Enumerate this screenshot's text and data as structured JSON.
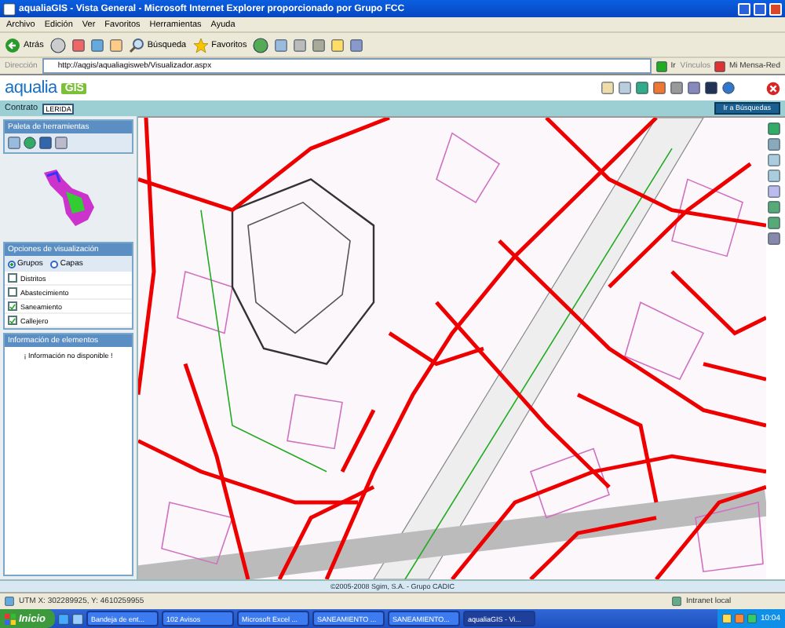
{
  "window": {
    "title": "aqualiaGIS - Vista General - Microsoft Internet Explorer proporcionado por Grupo FCC"
  },
  "menu": [
    "Archivo",
    "Edición",
    "Ver",
    "Favoritos",
    "Herramientas",
    "Ayuda"
  ],
  "toolbar": [
    {
      "kind": "back",
      "label": "Atrás"
    },
    {
      "kind": "search",
      "label": "Búsqueda"
    },
    {
      "kind": "favorites",
      "label": "Favoritos"
    }
  ],
  "address": {
    "label": "Dirección",
    "value": "http://aqgis/aqualiagisweb/Visualizador.aspx",
    "go": "Ir"
  },
  "links": {
    "label": "Vínculos",
    "item": "Mi Mensa-Red"
  },
  "logo": {
    "name": "aqualia",
    "suffix": "GIS"
  },
  "contract": {
    "label": "Contrato",
    "value": "LERIDA"
  },
  "search_button": "Ir a Búsquedas",
  "tool_palette": {
    "title": "Paleta de herramientas"
  },
  "display_options": {
    "title": "Opciones de visualización",
    "modes": [
      {
        "label": "Grupos",
        "selected": true
      },
      {
        "label": "Capas",
        "selected": false
      }
    ],
    "layers": [
      {
        "label": "Distritos",
        "checked": false
      },
      {
        "label": "Abastecimiento",
        "checked": false
      },
      {
        "label": "Saneamiento",
        "checked": true
      },
      {
        "label": "Callejero",
        "checked": true
      }
    ]
  },
  "info": {
    "title": "Información de elementos",
    "message": "¡ Información no disponible !"
  },
  "copyright": "©2005-2008 Sgim, S.A. - Grupo CADIC",
  "status": {
    "coordinates": "UTM X: 302289925, Y: 4610259955",
    "zone": "Intranet local"
  },
  "taskbar": {
    "start": "Inicio",
    "tasks": [
      {
        "label": "Bandeja de ent...",
        "selected": false
      },
      {
        "label": "102 Avisos",
        "selected": false
      },
      {
        "label": "Microsoft Excel ...",
        "selected": false
      },
      {
        "label": "SANEAMIENTO ...",
        "selected": false
      },
      {
        "label": "SANEAMIENTO...",
        "selected": false
      },
      {
        "label": "aqualiaGIS - Vi...",
        "selected": true
      }
    ],
    "clock": "10:04"
  }
}
